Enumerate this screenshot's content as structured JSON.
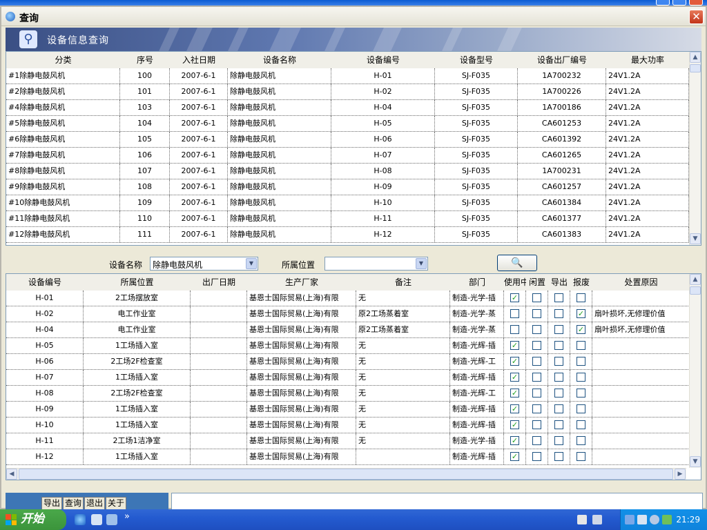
{
  "window": {
    "title": "查询",
    "close_label": "✕"
  },
  "banner": {
    "title": "设备信息查询"
  },
  "top_grid": {
    "headers": [
      "分类",
      "序号",
      "入社日期",
      "设备名称",
      "设备编号",
      "设备型号",
      "设备出厂编号",
      "最大功率"
    ],
    "rows": [
      [
        "#1除静电鼓风机",
        "100",
        "2007-6-1",
        "除静电鼓风机",
        "H-01",
        "SJ-F035",
        "1A700232",
        "24V1.2A"
      ],
      [
        "#2除静电鼓风机",
        "101",
        "2007-6-1",
        "除静电鼓风机",
        "H-02",
        "SJ-F035",
        "1A700226",
        "24V1.2A"
      ],
      [
        "#4除静电鼓风机",
        "103",
        "2007-6-1",
        "除静电鼓风机",
        "H-04",
        "SJ-F035",
        "1A700186",
        "24V1.2A"
      ],
      [
        "#5除静电鼓风机",
        "104",
        "2007-6-1",
        "除静电鼓风机",
        "H-05",
        "SJ-F035",
        "CA601253",
        "24V1.2A"
      ],
      [
        "#6除静电鼓风机",
        "105",
        "2007-6-1",
        "除静电鼓风机",
        "H-06",
        "SJ-F035",
        "CA601392",
        "24V1.2A"
      ],
      [
        "#7除静电鼓风机",
        "106",
        "2007-6-1",
        "除静电鼓风机",
        "H-07",
        "SJ-F035",
        "CA601265",
        "24V1.2A"
      ],
      [
        "#8除静电鼓风机",
        "107",
        "2007-6-1",
        "除静电鼓风机",
        "H-08",
        "SJ-F035",
        "1A700231",
        "24V1.2A"
      ],
      [
        "#9除静电鼓风机",
        "108",
        "2007-6-1",
        "除静电鼓风机",
        "H-09",
        "SJ-F035",
        "CA601257",
        "24V1.2A"
      ],
      [
        "#10除静电鼓风机",
        "109",
        "2007-6-1",
        "除静电鼓风机",
        "H-10",
        "SJ-F035",
        "CA601384",
        "24V1.2A"
      ],
      [
        "#11除静电鼓风机",
        "110",
        "2007-6-1",
        "除静电鼓风机",
        "H-11",
        "SJ-F035",
        "CA601377",
        "24V1.2A"
      ],
      [
        "#12除静电鼓风机",
        "111",
        "2007-6-1",
        "除静电鼓风机",
        "H-12",
        "SJ-F035",
        "CA601383",
        "24V1.2A"
      ]
    ]
  },
  "filter": {
    "name_label": "设备名称",
    "name_value": "除静电鼓风机",
    "location_label": "所属位置",
    "location_value": "",
    "find_icon": "binoculars-icon",
    "find_glyph": "🔍"
  },
  "bottom_grid": {
    "headers": [
      "设备编号",
      "所属位置",
      "出厂日期",
      "生产厂家",
      "备注",
      "部门",
      "使用中",
      "闲置",
      "导出",
      "报废",
      "处置原因"
    ],
    "rows": [
      {
        "code": "H-01",
        "loc": "2工场摆放室",
        "date": "",
        "maker": "基恩士国际贸易(上海)有限",
        "note": "无",
        "dept": "制造-光学-插",
        "inuse": true,
        "idle": false,
        "export": false,
        "scrap": false,
        "reason": ""
      },
      {
        "code": "H-02",
        "loc": "电工作业室",
        "date": "",
        "maker": "基恩士国际贸易(上海)有限",
        "note": "原2工场蒸着室",
        "dept": "制造-光学-蒸",
        "inuse": false,
        "idle": false,
        "export": false,
        "scrap": true,
        "reason": "扇叶损坏,无修理价值"
      },
      {
        "code": "H-04",
        "loc": "电工作业室",
        "date": "",
        "maker": "基恩士国际贸易(上海)有限",
        "note": "原2工场蒸着室",
        "dept": "制造-光学-蒸",
        "inuse": false,
        "idle": false,
        "export": false,
        "scrap": true,
        "reason": "扇叶损坏,无修理价值"
      },
      {
        "code": "H-05",
        "loc": "1工场插入室",
        "date": "",
        "maker": "基恩士国际贸易(上海)有限",
        "note": "无",
        "dept": "制造-光辉-插",
        "inuse": true,
        "idle": false,
        "export": false,
        "scrap": false,
        "reason": ""
      },
      {
        "code": "H-06",
        "loc": "2工场2F检查室",
        "date": "",
        "maker": "基恩士国际贸易(上海)有限",
        "note": "无",
        "dept": "制造-光辉-工",
        "inuse": true,
        "idle": false,
        "export": false,
        "scrap": false,
        "reason": ""
      },
      {
        "code": "H-07",
        "loc": "1工场插入室",
        "date": "",
        "maker": "基恩士国际贸易(上海)有限",
        "note": "无",
        "dept": "制造-光辉-插",
        "inuse": true,
        "idle": false,
        "export": false,
        "scrap": false,
        "reason": ""
      },
      {
        "code": "H-08",
        "loc": "2工场2F检查室",
        "date": "",
        "maker": "基恩士国际贸易(上海)有限",
        "note": "无",
        "dept": "制造-光辉-工",
        "inuse": true,
        "idle": false,
        "export": false,
        "scrap": false,
        "reason": ""
      },
      {
        "code": "H-09",
        "loc": "1工场插入室",
        "date": "",
        "maker": "基恩士国际贸易(上海)有限",
        "note": "无",
        "dept": "制造-光辉-插",
        "inuse": true,
        "idle": false,
        "export": false,
        "scrap": false,
        "reason": ""
      },
      {
        "code": "H-10",
        "loc": "1工场插入室",
        "date": "",
        "maker": "基恩士国际贸易(上海)有限",
        "note": "无",
        "dept": "制造-光辉-插",
        "inuse": true,
        "idle": false,
        "export": false,
        "scrap": false,
        "reason": ""
      },
      {
        "code": "H-11",
        "loc": "2工场1洁净室",
        "date": "",
        "maker": "基恩士国际贸易(上海)有限",
        "note": "无",
        "dept": "制造-光学-插",
        "inuse": true,
        "idle": false,
        "export": false,
        "scrap": false,
        "reason": ""
      },
      {
        "code": "H-12",
        "loc": "1工场插入室",
        "date": "",
        "maker": "基恩士国际贸易(上海)有限",
        "note": "",
        "dept": "制造-光辉-插",
        "inuse": true,
        "idle": false,
        "export": false,
        "scrap": false,
        "reason": ""
      }
    ]
  },
  "toolbar": {
    "export": "导出",
    "query": "查询",
    "exit": "退出",
    "about": "关于"
  },
  "taskbar": {
    "start": "开始",
    "clock": "21:29",
    "more": "»"
  },
  "colors": {
    "accent": "#245bd0",
    "banner": "#5f78b0",
    "check": "#21a121"
  }
}
